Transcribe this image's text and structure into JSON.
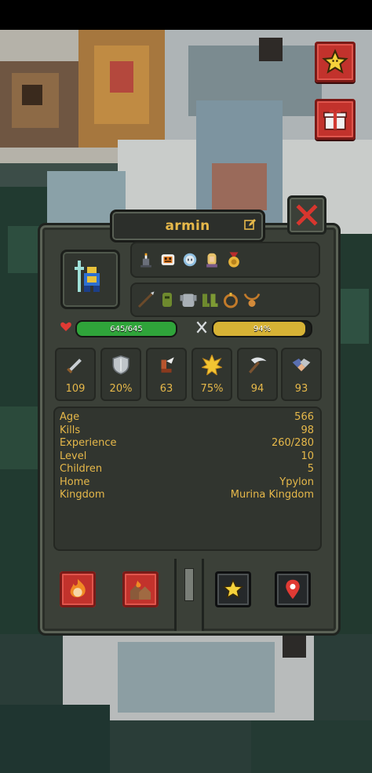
{
  "character": {
    "name": "armin",
    "health": "645/645",
    "health_fraction": 1.0,
    "hunger": "94%",
    "hunger_fraction": 0.94
  },
  "traits": [
    "candle-trait-icon",
    "pumpkin-face-trait-icon",
    "frozen-skull-trait-icon",
    "blonde-woman-trait-icon",
    "gold-medal-trait-icon"
  ],
  "equipment": [
    "spear-icon",
    "green-helmet-icon",
    "steel-armor-icon",
    "boots-icon",
    "ring-icon",
    "amulet-icon"
  ],
  "stats": [
    {
      "name": "damage",
      "icon": "sword-icon",
      "value": "109"
    },
    {
      "name": "armor",
      "icon": "shield-icon",
      "value": "20%"
    },
    {
      "name": "speed",
      "icon": "winged-boot-icon",
      "value": "63"
    },
    {
      "name": "crit",
      "icon": "star-burst-icon",
      "value": "75%"
    },
    {
      "name": "attack-speed",
      "icon": "scythe-icon",
      "value": "94"
    },
    {
      "name": "diplomacy",
      "icon": "handshake-icon",
      "value": "93"
    }
  ],
  "info": [
    {
      "label": "Age",
      "value": "566"
    },
    {
      "label": "Kills",
      "value": "98"
    },
    {
      "label": "Experience",
      "value": "260/280"
    },
    {
      "label": "Level",
      "value": "10"
    },
    {
      "label": "Children",
      "value": "5"
    },
    {
      "label": "Home",
      "value": "Ypylon"
    },
    {
      "label": "Kingdom",
      "value": "Murina Kingdom"
    }
  ],
  "colors": {
    "accent_text": "#e6b84a",
    "health_bar": "#2fa43a",
    "hunger_bar": "#d6b235",
    "red_button": "#c2322c",
    "panel": "#3b4038"
  }
}
